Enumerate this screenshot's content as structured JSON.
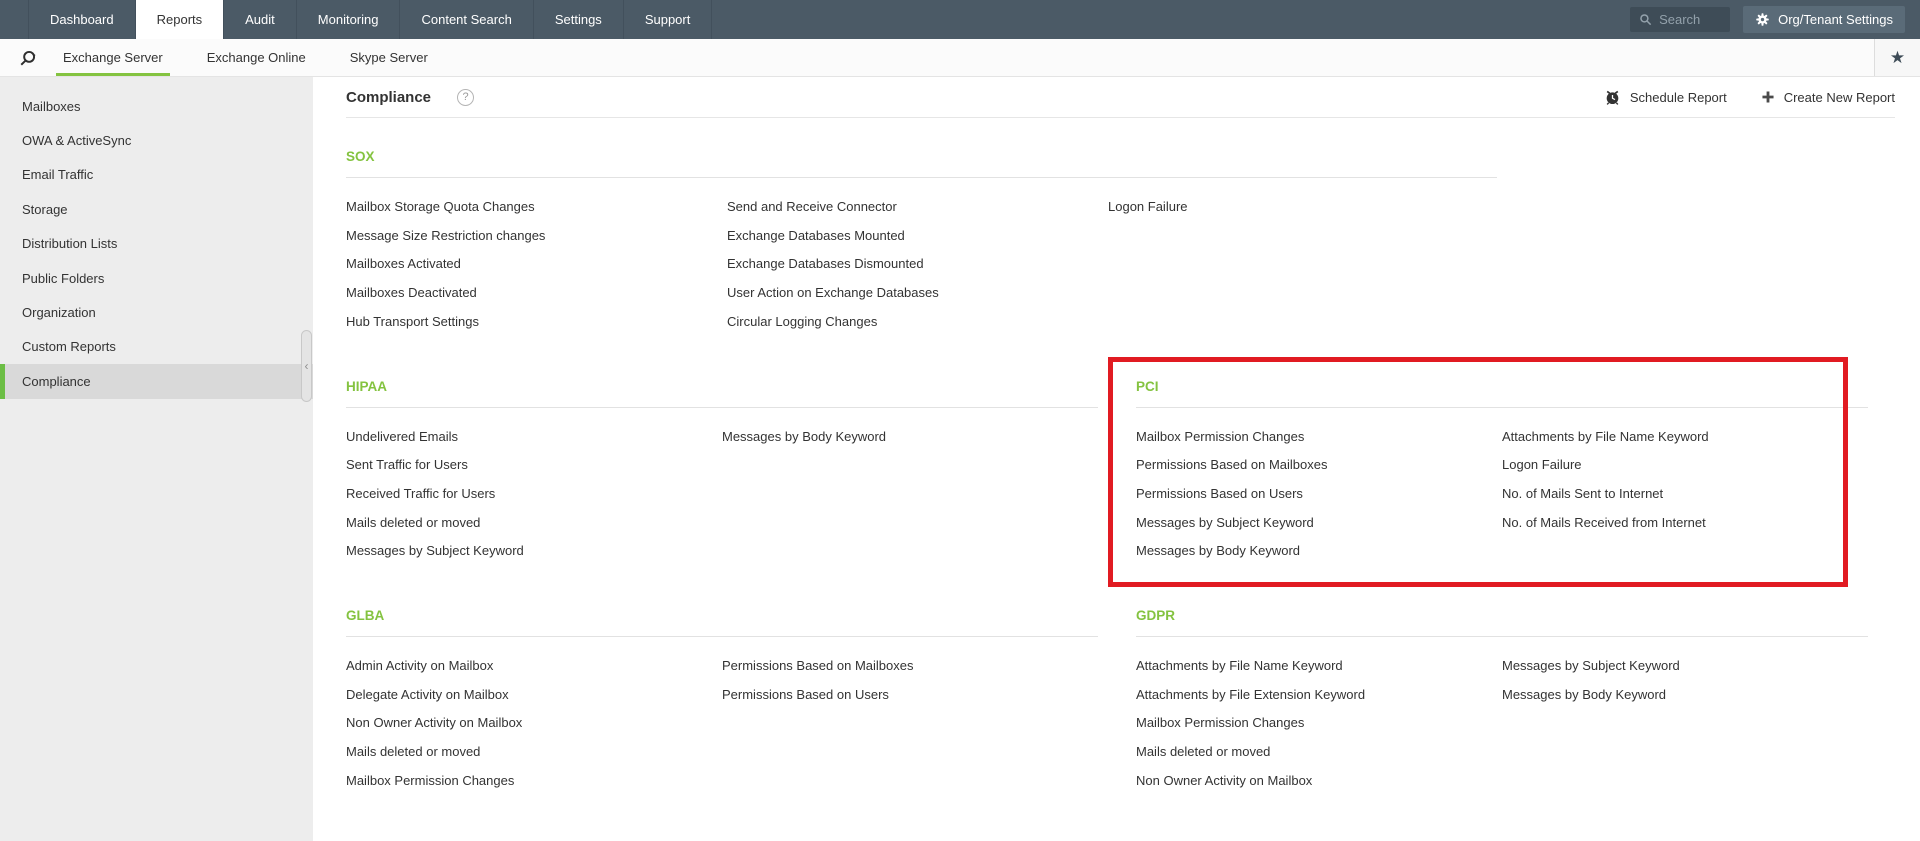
{
  "colors": {
    "topnav_bg": "#4b5a66",
    "search_box_bg": "#3e4c57",
    "org_button_bg": "#5a6b78",
    "accent_green": "#84c340",
    "sidebar_bg": "#ededed",
    "selected_item_bg": "#d9d9d9",
    "highlight_red": "#e11b22",
    "link_text": "#333333"
  },
  "icons": {
    "favorite_star": "★",
    "help": "?",
    "gripper_chevron": "‹"
  },
  "topnav": {
    "tabs": [
      {
        "label": "Dashboard",
        "state": ""
      },
      {
        "label": "Reports",
        "state": "active"
      },
      {
        "label": "Audit",
        "state": ""
      },
      {
        "label": "Monitoring",
        "state": ""
      },
      {
        "label": "Content Search",
        "state": ""
      },
      {
        "label": "Settings",
        "state": ""
      },
      {
        "label": "Support",
        "state": ""
      }
    ],
    "search": {
      "placeholder": "Search"
    },
    "org_settings_label": "Org/Tenant Settings"
  },
  "subnav": {
    "tabs": [
      {
        "label": "Exchange Server",
        "state": "active"
      },
      {
        "label": "Exchange Online",
        "state": ""
      },
      {
        "label": "Skype Server",
        "state": ""
      }
    ]
  },
  "sidebar": {
    "items": [
      {
        "label": "Mailboxes",
        "state": ""
      },
      {
        "label": "OWA & ActiveSync",
        "state": ""
      },
      {
        "label": "Email Traffic",
        "state": ""
      },
      {
        "label": "Storage",
        "state": ""
      },
      {
        "label": "Distribution Lists",
        "state": ""
      },
      {
        "label": "Public Folders",
        "state": ""
      },
      {
        "label": "Organization",
        "state": ""
      },
      {
        "label": "Custom Reports",
        "state": ""
      },
      {
        "label": "Compliance",
        "state": "selected"
      }
    ]
  },
  "main": {
    "title": "Compliance",
    "actions": {
      "schedule_label": "Schedule Report",
      "create_label": "Create New Report"
    },
    "sections": [
      {
        "title": "SOX",
        "variant": "wide",
        "highlighted": false,
        "columns": [
          [
            "Mailbox Storage Quota Changes",
            "Message Size Restriction changes",
            "Mailboxes Activated",
            "Mailboxes Deactivated",
            "Hub Transport Settings"
          ],
          [
            "Send and Receive Connector",
            "Exchange Databases Mounted",
            "Exchange Databases Dismounted",
            "User Action on Exchange Databases",
            "Circular Logging Changes"
          ],
          [
            "Logon Failure"
          ]
        ]
      },
      {
        "title": "HIPAA",
        "variant": "",
        "highlighted": false,
        "columns": [
          [
            "Undelivered Emails",
            "Sent Traffic for Users",
            "Received Traffic for Users",
            "Mails deleted or moved",
            "Messages by Subject Keyword"
          ],
          [
            "Messages by Body Keyword"
          ]
        ]
      },
      {
        "title": "PCI",
        "variant": "right",
        "highlighted": true,
        "columns": [
          [
            "Mailbox Permission Changes",
            "Permissions Based on Mailboxes",
            "Permissions Based on Users",
            "Messages by Subject Keyword",
            "Messages by Body Keyword"
          ],
          [
            "Attachments by File Name Keyword",
            "Logon Failure",
            "No. of Mails Sent to Internet",
            "No. of Mails Received from Internet"
          ]
        ]
      },
      {
        "title": "GLBA",
        "variant": "",
        "highlighted": false,
        "columns": [
          [
            "Admin Activity on Mailbox",
            "Delegate Activity on Mailbox",
            "Non Owner Activity on Mailbox",
            "Mails deleted or moved",
            "Mailbox Permission Changes"
          ],
          [
            "Permissions Based on Mailboxes",
            "Permissions Based on Users"
          ]
        ]
      },
      {
        "title": "GDPR",
        "variant": "right",
        "highlighted": false,
        "columns": [
          [
            "Attachments by File Name Keyword",
            "Attachments by File Extension Keyword",
            "Mailbox Permission Changes",
            "Mails deleted or moved",
            "Non Owner Activity on Mailbox"
          ],
          [
            "Messages by Subject Keyword",
            "Messages by Body Keyword"
          ]
        ]
      }
    ]
  }
}
